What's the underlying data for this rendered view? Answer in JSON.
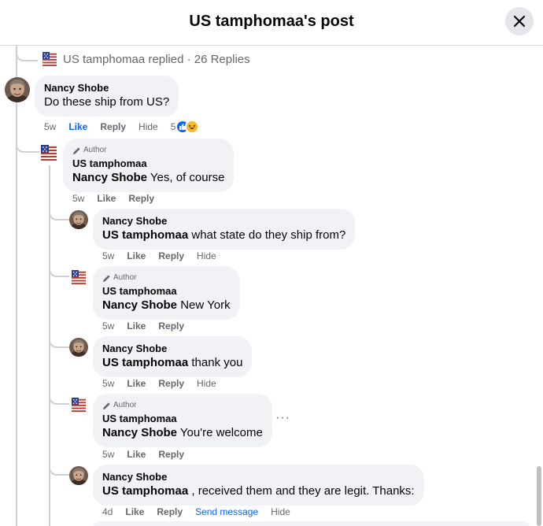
{
  "header": {
    "title": "US tamphomaa's post"
  },
  "thread": {
    "replied_label": "US tamphomaa replied · 26 Replies"
  },
  "comments": [
    {
      "name": "Nancy Shobe",
      "text": "Do these ship from US?",
      "time": "5w",
      "like": "Like",
      "reply": "Reply",
      "hide": "Hide",
      "reactions": "5"
    },
    {
      "badge": "Author",
      "name": "US tamphomaa",
      "mention": "Nancy Shobe",
      "text": " Yes, of course",
      "time": "5w",
      "like": "Like",
      "reply": "Reply"
    },
    {
      "name": "Nancy Shobe",
      "mention": "US tamphomaa",
      "text": " what state do they ship from?",
      "time": "5w",
      "like": "Like",
      "reply": "Reply",
      "hide": "Hide"
    },
    {
      "badge": "Author",
      "name": "US tamphomaa",
      "mention": "Nancy Shobe",
      "text": " New York",
      "time": "5w",
      "like": "Like",
      "reply": "Reply"
    },
    {
      "name": "Nancy Shobe",
      "mention": "US tamphomaa",
      "text": " thank you",
      "time": "5w",
      "like": "Like",
      "reply": "Reply",
      "hide": "Hide"
    },
    {
      "badge": "Author",
      "name": "US tamphomaa",
      "mention": "Nancy Shobe",
      "text": " You're welcome",
      "time": "5w",
      "like": "Like",
      "reply": "Reply"
    },
    {
      "name": "Nancy Shobe",
      "mention": "US tamphomaa",
      "text": " , received them and they are legit. Thanks:",
      "time": "4d",
      "like": "Like",
      "reply": "Reply",
      "send": "Send message",
      "hide": "Hide"
    }
  ],
  "colors": {
    "accent": "#0866ff",
    "bubble": "#f0f2f5",
    "muted": "#65676b",
    "line": "#ced0d4"
  },
  "icons": {
    "close": "close-icon",
    "author": "pencil-icon",
    "more": "more-icon",
    "like_reaction": "thumbs-up-icon",
    "haha_reaction": "haha-icon"
  }
}
